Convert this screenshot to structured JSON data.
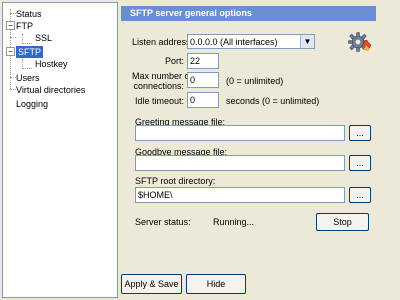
{
  "tree": {
    "items": [
      {
        "label": "Status"
      },
      {
        "label": "FTP",
        "expander": "−"
      },
      {
        "label": "SSL"
      },
      {
        "label": "SFTP",
        "expander": "−"
      },
      {
        "label": "Hostkey"
      },
      {
        "label": "Users"
      },
      {
        "label": "Virtual directories"
      },
      {
        "label": "Logging"
      }
    ]
  },
  "panel": {
    "title": "SFTP server general options",
    "listen_address": {
      "label": "Listen address:",
      "value": "0.0.0.0 (All interfaces)"
    },
    "port": {
      "label": "Port:",
      "value": "22"
    },
    "max_connections": {
      "label_line1": "Max number of",
      "label_line2": "connections:",
      "value": "0",
      "hint": "(0 = unlimited)"
    },
    "idle_timeout": {
      "label": "Idle timeout:",
      "value": "0",
      "hint": "seconds (0 = unlimited)"
    },
    "greeting": {
      "label": "Greeting message file:",
      "value": "",
      "browse": "..."
    },
    "goodbye": {
      "label": "Goodbye message file:",
      "value": "",
      "browse": "..."
    },
    "root_dir": {
      "label": "SFTP root directory:",
      "value": "$HOME\\",
      "browse": "..."
    },
    "status": {
      "label": "Server status:",
      "value": "Running...",
      "button": "Stop"
    }
  },
  "footer": {
    "apply_label": "Apply & Save",
    "hide_label": "Hide"
  },
  "icons": {
    "settings": "gear-icon"
  }
}
